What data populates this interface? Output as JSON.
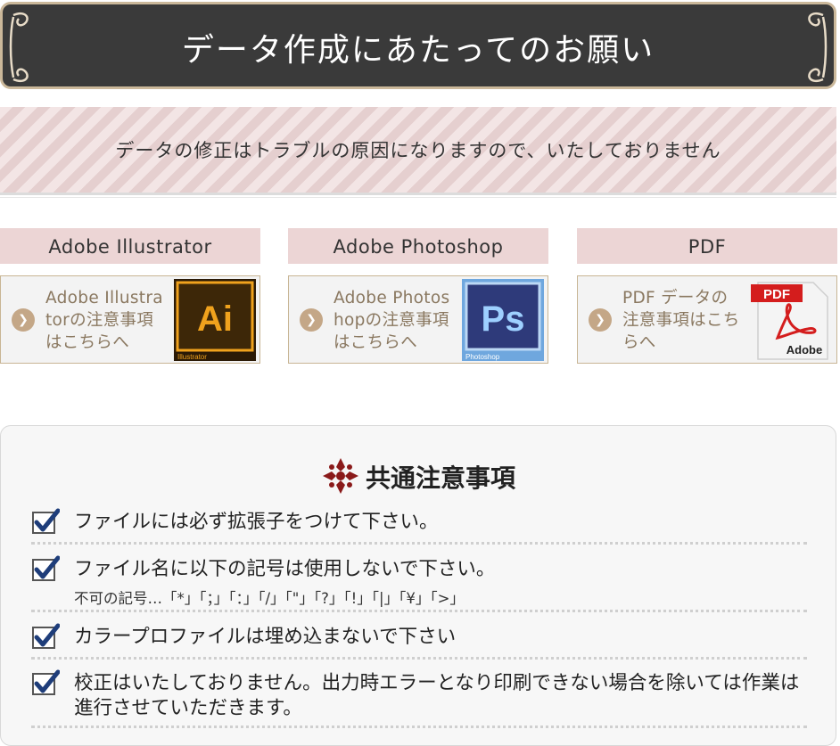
{
  "header": {
    "title": "データ作成にあたってのお願い"
  },
  "banner": {
    "text": "データの修正はトラブルの原因になりますので、いたしておりません"
  },
  "software": [
    {
      "heading": "Adobe Illustrator",
      "link_label": "Adobe Illustratorの注意事項はこちらへ",
      "logo_letters": "Ai",
      "logo_caption": "Illustrator"
    },
    {
      "heading": "Adobe Photoshop",
      "link_label": "Adobe Photoshopの注意事項はこちらへ",
      "logo_letters": "Ps",
      "logo_caption": "Photoshop"
    },
    {
      "heading": "PDF",
      "link_label": "PDF データの注意事項はこちらへ",
      "logo_letters": "PDF",
      "logo_caption": "Adobe"
    }
  ],
  "notes": {
    "title": "共通注意事項",
    "items": [
      {
        "text": "ファイルには必ず拡張子をつけて下さい。"
      },
      {
        "text": "ファイル名に以下の記号は使用しないで下さい。",
        "sub": "不可の記号…「*」「；」「：」「/」「\"」「?」「!」「|」「¥」「>」"
      },
      {
        "text": "カラープロファイルは埋め込まないで下さい"
      },
      {
        "text": "校正はいたしておりません。出力時エラーとなり印刷できない場合を除いては作業は進行させていただきます。"
      }
    ]
  },
  "colors": {
    "header_bg": "#3a3a3a",
    "accent_pink": "#ecd5d5",
    "chevron": "#c4a787",
    "check_blue": "#1e3d7a"
  }
}
